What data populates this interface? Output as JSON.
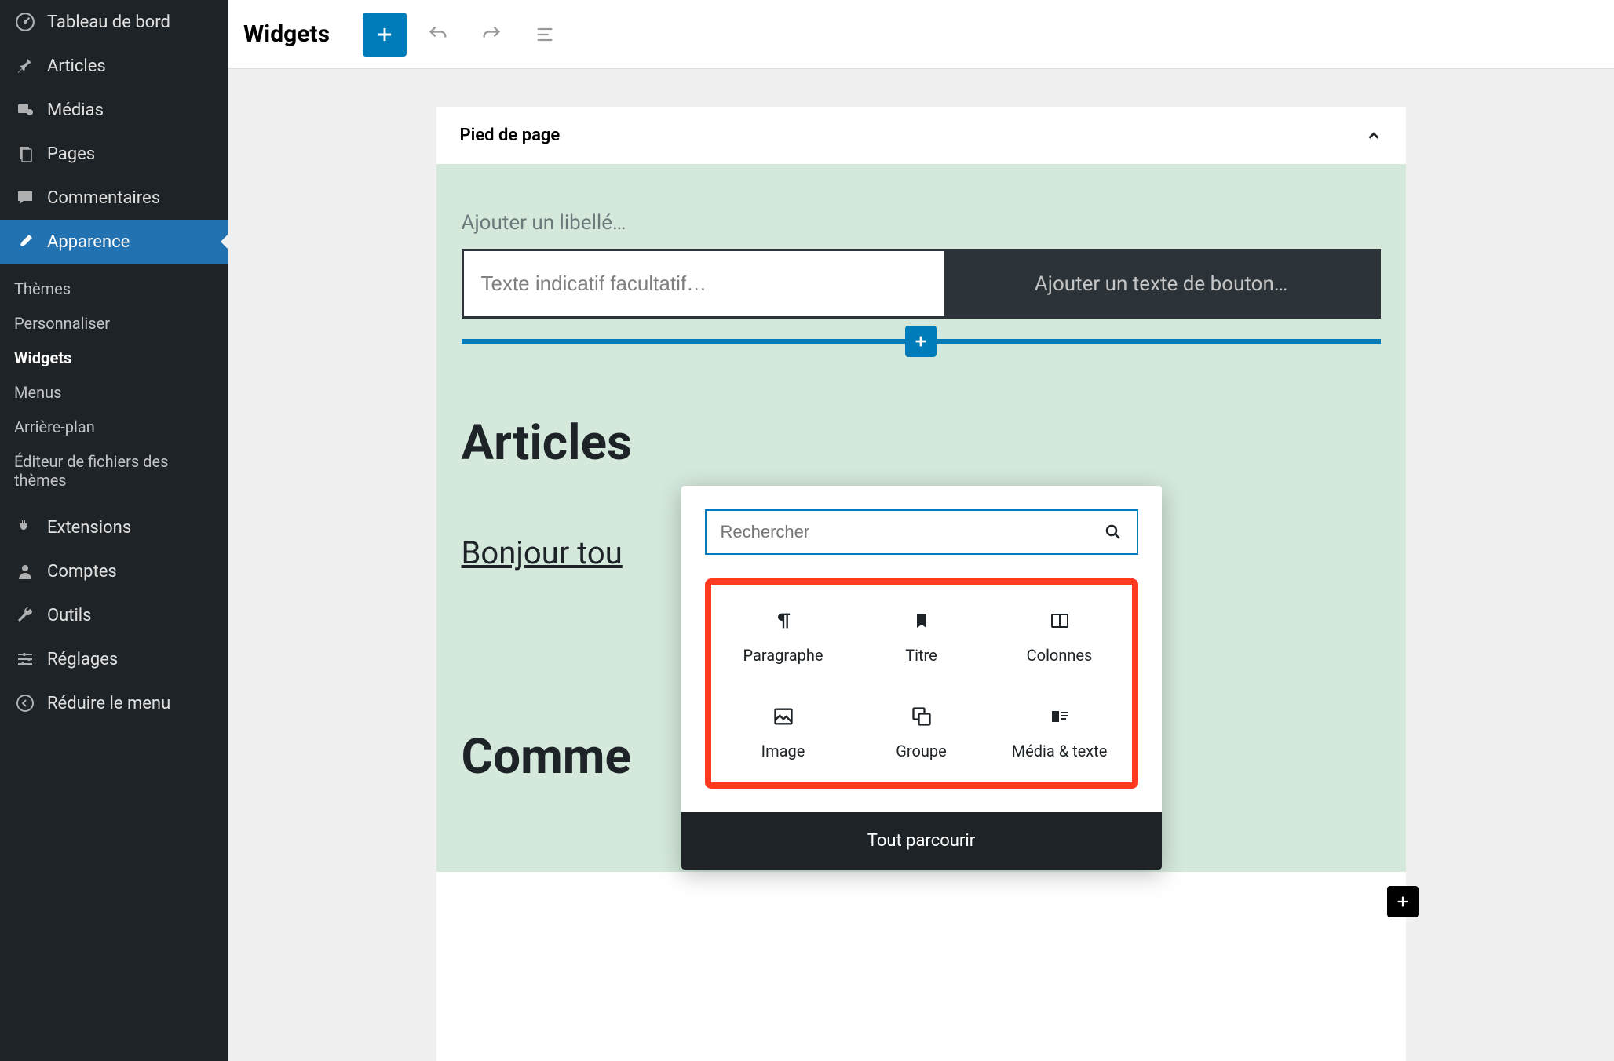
{
  "sidebar": {
    "items": [
      {
        "label": "Tableau de bord"
      },
      {
        "label": "Articles"
      },
      {
        "label": "Médias"
      },
      {
        "label": "Pages"
      },
      {
        "label": "Commentaires"
      },
      {
        "label": "Apparence"
      },
      {
        "label": "Extensions"
      },
      {
        "label": "Comptes"
      },
      {
        "label": "Outils"
      },
      {
        "label": "Réglages"
      },
      {
        "label": "Réduire le menu"
      }
    ],
    "submenu": [
      {
        "label": "Thèmes"
      },
      {
        "label": "Personnaliser"
      },
      {
        "label": "Widgets"
      },
      {
        "label": "Menus"
      },
      {
        "label": "Arrière-plan"
      },
      {
        "label": "Éditeur de fichiers des thèmes"
      }
    ]
  },
  "topbar": {
    "title": "Widgets"
  },
  "panel": {
    "title": "Pied de page"
  },
  "widget": {
    "label_placeholder": "Ajouter un libellé…",
    "search_placeholder": "Texte indicatif facultatif…",
    "button_placeholder": "Ajouter un texte de bouton…",
    "heading": "Articles",
    "post_link": "Bonjour tou",
    "heading2": "Comme"
  },
  "inserter": {
    "search_placeholder": "Rechercher",
    "blocks": [
      {
        "label": "Paragraphe"
      },
      {
        "label": "Titre"
      },
      {
        "label": "Colonnes"
      },
      {
        "label": "Image"
      },
      {
        "label": "Groupe"
      },
      {
        "label": "Média & texte"
      }
    ],
    "browse_all": "Tout parcourir"
  }
}
